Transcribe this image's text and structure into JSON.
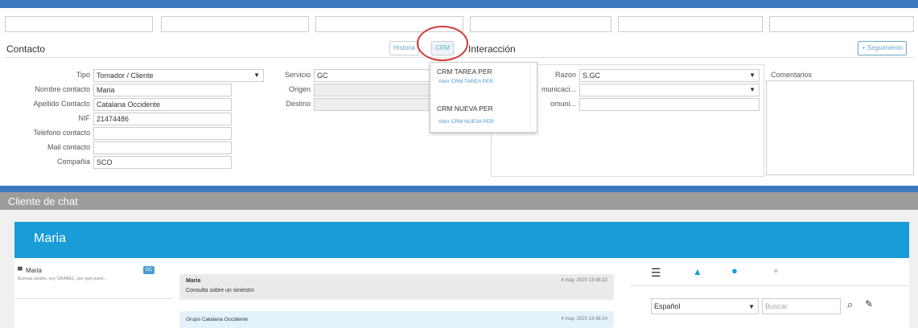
{
  "contacto": {
    "title": "Contacto",
    "historia_label": "Historia",
    "crm_label": "CRM",
    "fields": [
      {
        "label": "Tipo",
        "value": "Tomador / Cliente"
      },
      {
        "label": "Nombre contacto",
        "value": "Maria"
      },
      {
        "label": "Apellido Contacto",
        "value": "Catalana Occidente"
      },
      {
        "label": "NIF",
        "value": "21474486"
      },
      {
        "label": "Telefono contacto",
        "value": ""
      },
      {
        "label": "Mail contacto",
        "value": ""
      },
      {
        "label": "Compañia",
        "value": "SCO"
      }
    ],
    "servicio": {
      "label": "Servicio",
      "value": "GC"
    },
    "origen": {
      "label": "Origen",
      "value": ""
    },
    "destino": {
      "label": "Destino",
      "value": ""
    }
  },
  "interaccion": {
    "title": "Interacción",
    "seguimiento_label": "+ Seguimiento",
    "razon": {
      "label": "Razon",
      "value": "S.GC"
    },
    "comunicacion": {
      "label": "municaci...",
      "value": ""
    },
    "comuni2": {
      "label": "omuni...",
      "value": ""
    },
    "comentarios_label": "Comentarios"
  },
  "crm_dropdown": {
    "items": [
      {
        "title": "CRM TAREA PER",
        "link": "Abrir CRM TAREA PER"
      },
      {
        "title": "CRM NUEVA PER",
        "link": "Abrir CRM NUEVA PER"
      }
    ]
  },
  "chat": {
    "header": "Cliente de chat",
    "contact_name": "Maria",
    "sidebar": {
      "name": "Maria",
      "badge": "GC",
      "preview": "Buenas tardes, soy GRABEL, por qué pued..."
    },
    "messages": [
      {
        "author": "Maria",
        "time": "4 may. 2020 13:48:22",
        "text": "Consulta sobre un siniestro"
      },
      {
        "author": "Grupo Catalana Occidente",
        "time": "4 may. 2020 13:48:24",
        "text": ""
      }
    ],
    "right": {
      "language": "Español",
      "search_placeholder": "Buscar"
    }
  },
  "colors": {
    "accent": "#1a9cd8",
    "topbar": "#3a78c0",
    "annotation": "#d23a3a"
  }
}
